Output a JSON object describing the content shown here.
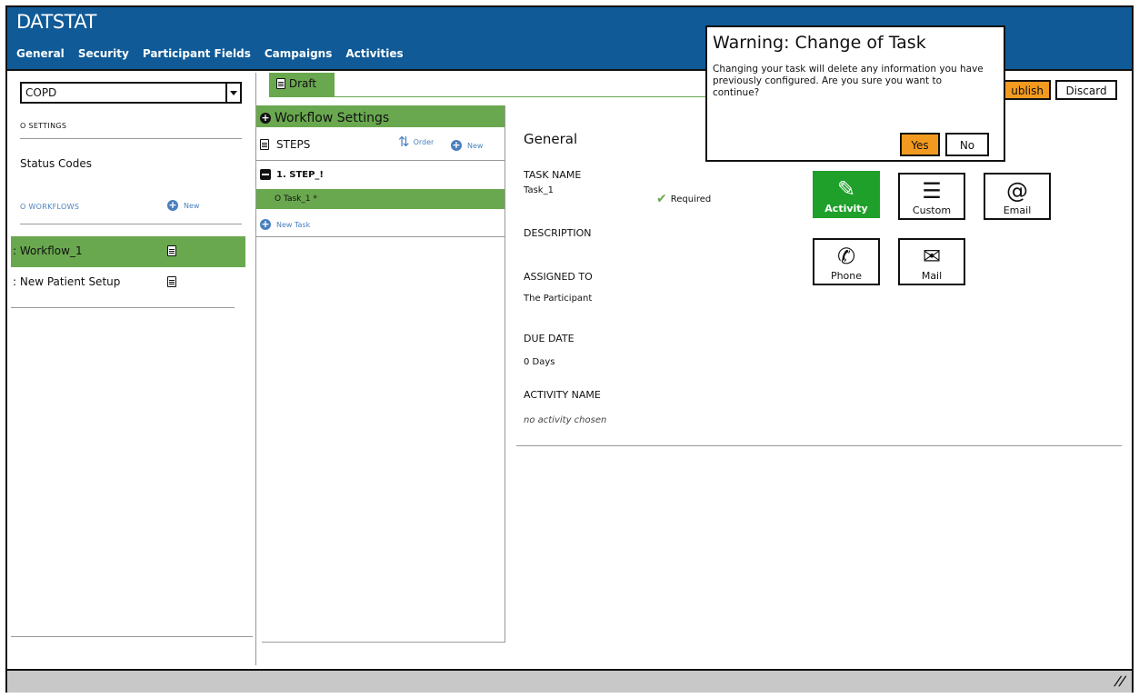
{
  "app": {
    "title": "DATSTAT"
  },
  "nav": [
    "General",
    "Security",
    "Participant Fields",
    "Campaigns",
    "Activities"
  ],
  "draft_tab": "Draft",
  "sidebar": {
    "program": "COPD",
    "settings_label": "O SETTINGS",
    "status_codes": "Status Codes",
    "workflows_label": "O WORKFLOWS",
    "new_label": "New",
    "workflows": [
      {
        "label": ": Workflow_1"
      },
      {
        "label": ": New Patient Setup"
      }
    ]
  },
  "middle": {
    "workflow_settings": "Workflow Settings",
    "steps": "STEPS",
    "order": "Order",
    "new": "New",
    "step": "1. STEP_!",
    "task": "O Task_1 *",
    "new_task": "New Task"
  },
  "detail": {
    "heading": "General",
    "task_name_label": "TASK NAME",
    "task_name_value": "Task_1",
    "required": "Required",
    "description_label": "DESCRIPTION",
    "assigned_to_label": "ASSIGNED TO",
    "assigned_to_value": "The Participant",
    "due_date_label": "DUE DATE",
    "due_date_value": "0 Days",
    "activity_name_label": "ACTIVITY NAME",
    "activity_name_value": "no activity chosen",
    "task_types": [
      {
        "label": "Activity",
        "icon": "pencil-icon"
      },
      {
        "label": "Custom",
        "icon": "list-icon"
      },
      {
        "label": "Email",
        "icon": "at-icon"
      },
      {
        "label": "Phone",
        "icon": "phone-icon"
      },
      {
        "label": "Mail",
        "icon": "envelope-icon"
      }
    ]
  },
  "toolbar": {
    "publish": "ublish",
    "discard": "Discard"
  },
  "modal": {
    "title": "Warning: Change of Task",
    "body": "Changing your task will delete any information you have previously configured. Are you sure you want to continue?",
    "yes": "Yes",
    "no": "No"
  },
  "colors": {
    "header": "#0f5a97",
    "green": "#6aa84f",
    "active_green": "#1fa02b",
    "orange": "#f29a1f",
    "link_blue": "#4a7fbe"
  }
}
